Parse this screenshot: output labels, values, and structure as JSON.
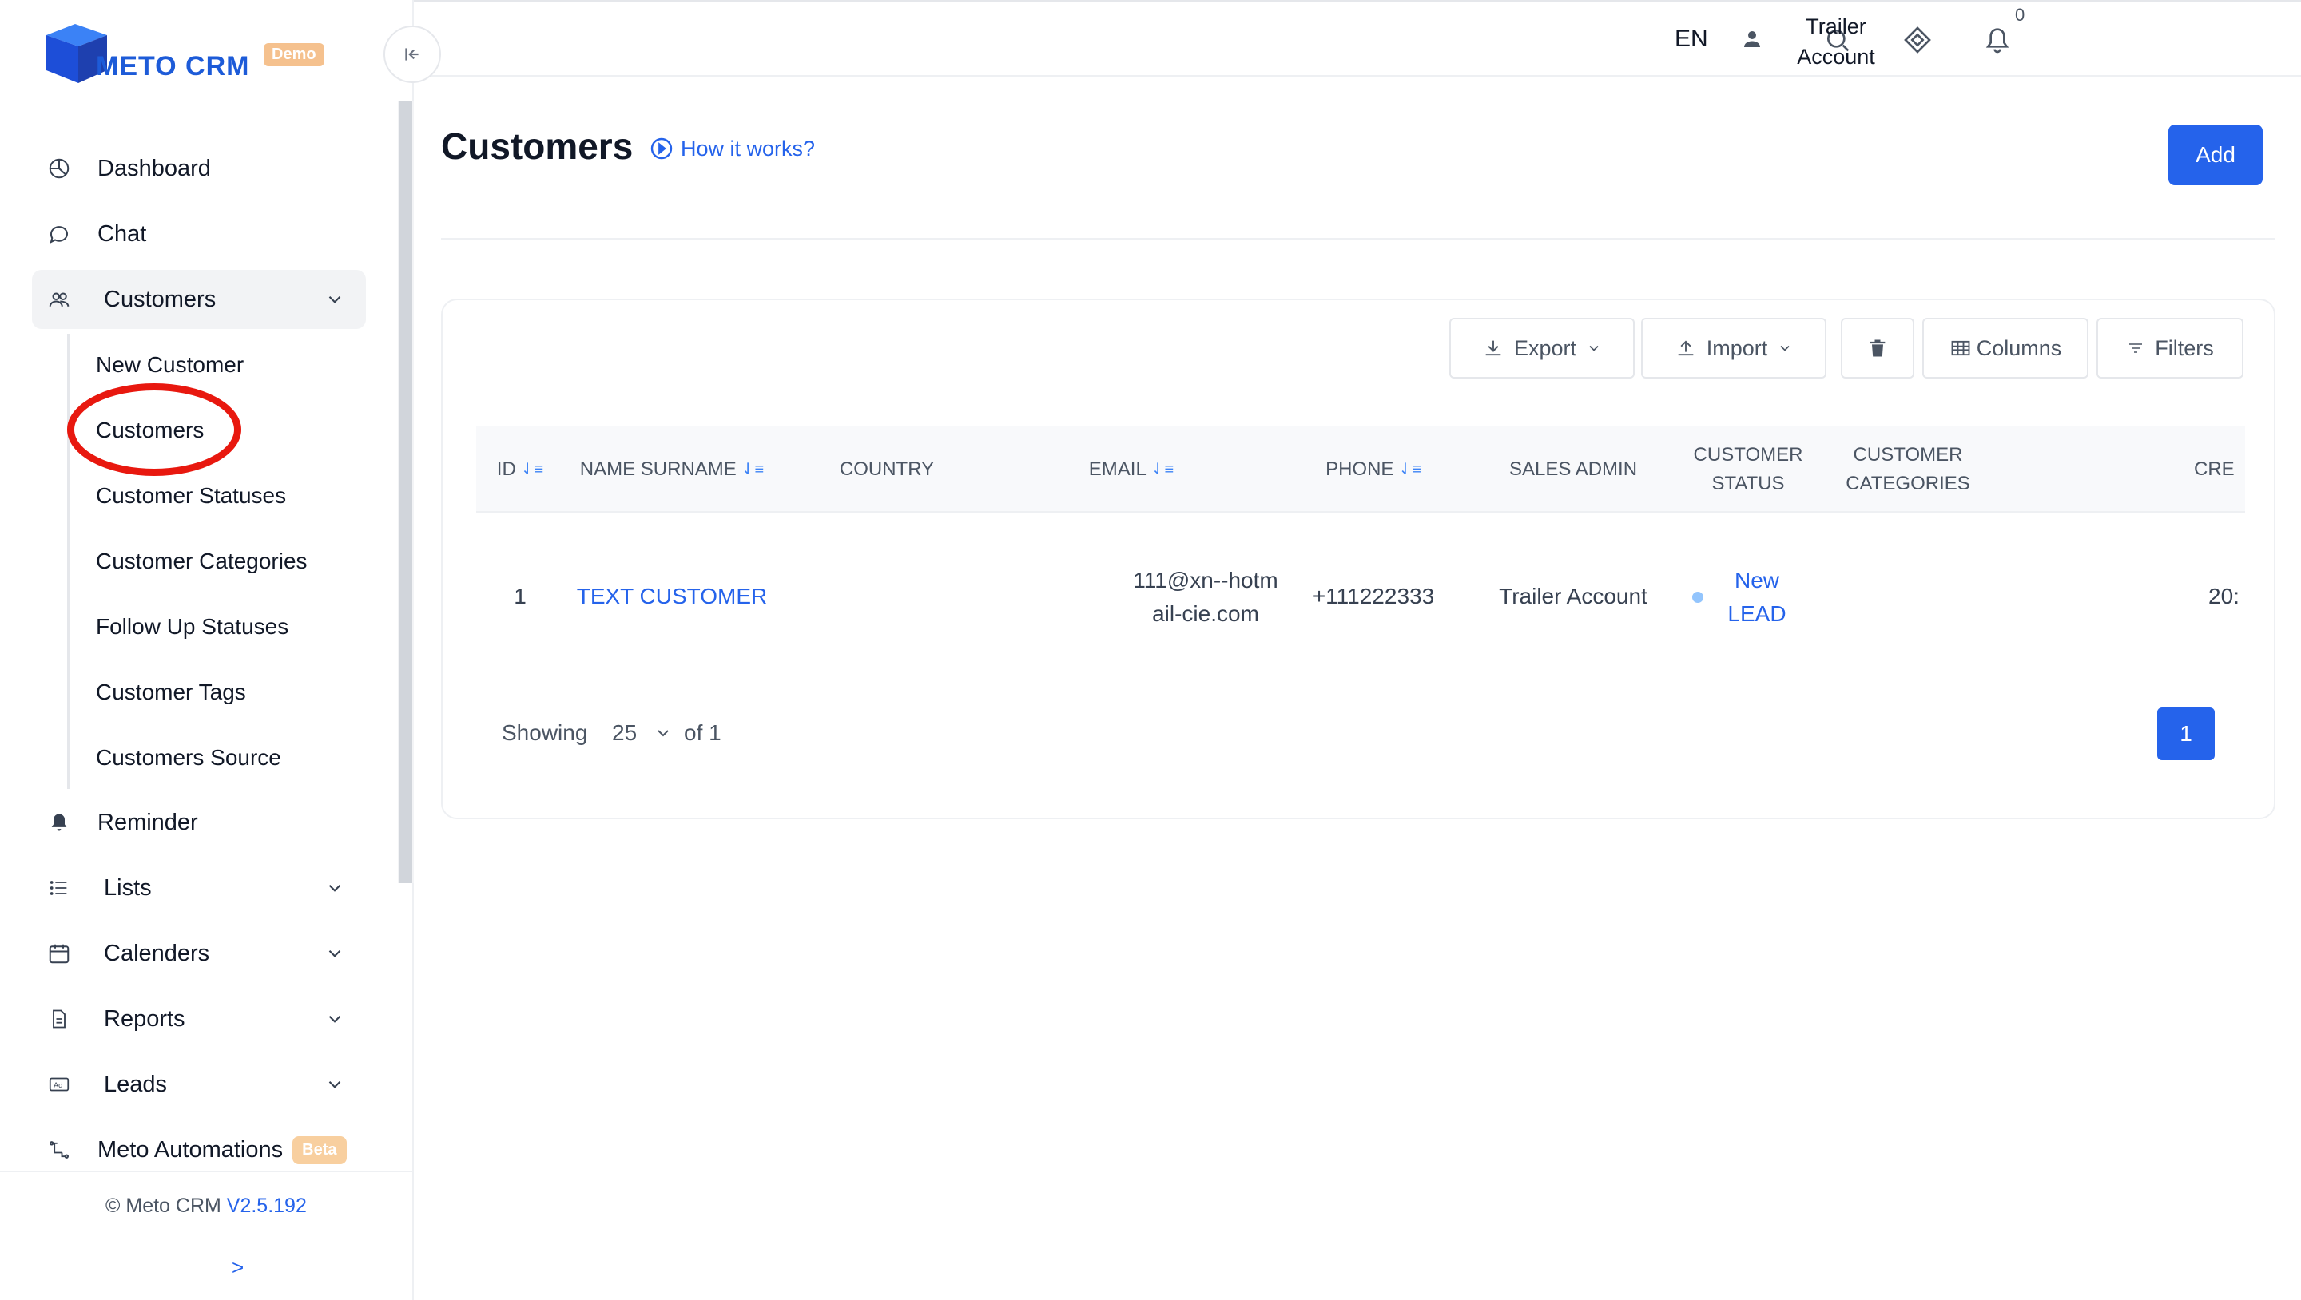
{
  "brand": {
    "name": "METO CRM",
    "badge": "Demo",
    "color": "#1d5bd8"
  },
  "sidebar": {
    "collapse_icon": "collapse-left-icon",
    "items": [
      {
        "label": "Dashboard",
        "icon": "dashboard-icon"
      },
      {
        "label": "Chat",
        "icon": "chat-icon"
      },
      {
        "label": "Customers",
        "icon": "users-icon",
        "expanded": true
      },
      {
        "label": "Reminder",
        "icon": "bell-icon"
      },
      {
        "label": "Lists",
        "icon": "list-icon"
      },
      {
        "label": "Calenders",
        "icon": "calendar-icon"
      },
      {
        "label": "Reports",
        "icon": "report-icon"
      },
      {
        "label": "Leads",
        "icon": "ad-icon"
      },
      {
        "label": "Meto Automations",
        "icon": "automation-icon",
        "badge": "Beta"
      }
    ],
    "sub_items": [
      "New Customer",
      "Customers",
      "Customer Statuses",
      "Customer Categories",
      "Follow Up Statuses",
      "Customer Tags",
      "Customers Source"
    ],
    "footer": {
      "copyright": "© Meto CRM",
      "version": "V2.5.192",
      "expand": ">"
    }
  },
  "topbar": {
    "notification_count": "0",
    "language": "EN",
    "user": "Trailer Account"
  },
  "page": {
    "title": "Customers",
    "how_it_works": "How it works?",
    "add_label": "Add"
  },
  "toolbar": {
    "export": "Export",
    "import": "Import",
    "columns": "Columns",
    "filters": "Filters"
  },
  "table": {
    "headers": [
      "ID",
      "NAME SURNAME",
      "COUNTRY",
      "EMAIL",
      "PHONE",
      "SALES ADMIN",
      "CUSTOMER STATUS",
      "CUSTOMER CATEGORIES",
      "CRE"
    ],
    "rows": [
      {
        "id": "1",
        "name": "TEXT CUSTOMER",
        "country": "",
        "email": "111@xn--hotmail-cie.com",
        "phone": "+111222333",
        "sales_admin": "Trailer Account",
        "status": "New LEAD",
        "categories": "",
        "created": "20:"
      }
    ]
  },
  "pagination": {
    "showing": "Showing",
    "page_size": "25",
    "of": "of 1",
    "current_page": "1"
  },
  "colors": {
    "accent": "#2563eb",
    "highlight_circle": "#e8180f"
  }
}
